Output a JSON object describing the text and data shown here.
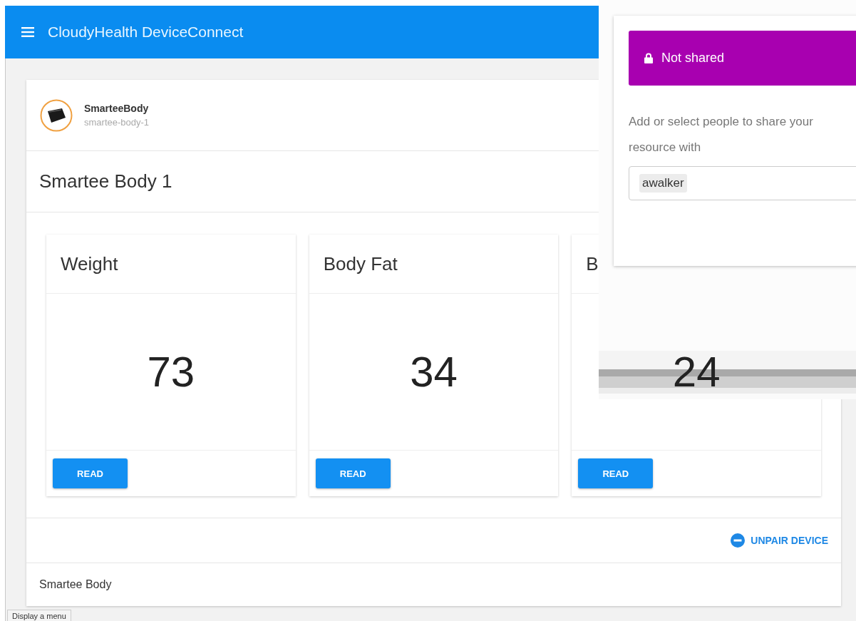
{
  "app_bar": {
    "title": "CloudyHealth DeviceConnect"
  },
  "device": {
    "name": "SmarteeBody",
    "id": "smartee-body-1",
    "title": "Smartee Body 1",
    "metrics": [
      {
        "label": "Weight",
        "value": "73",
        "button": "READ"
      },
      {
        "label": "Body Fat",
        "value": "34",
        "button": "READ"
      },
      {
        "label": "B",
        "value": "24",
        "button": "READ"
      }
    ],
    "unpair_button": "UNPAIR DEVICE",
    "footer": "Smartee Body"
  },
  "share_dialog": {
    "status": "Not shared",
    "shared": false,
    "prompt": "Add or select people to share your resource with",
    "people": [
      "awalker"
    ]
  },
  "status_text": "Display a menu"
}
